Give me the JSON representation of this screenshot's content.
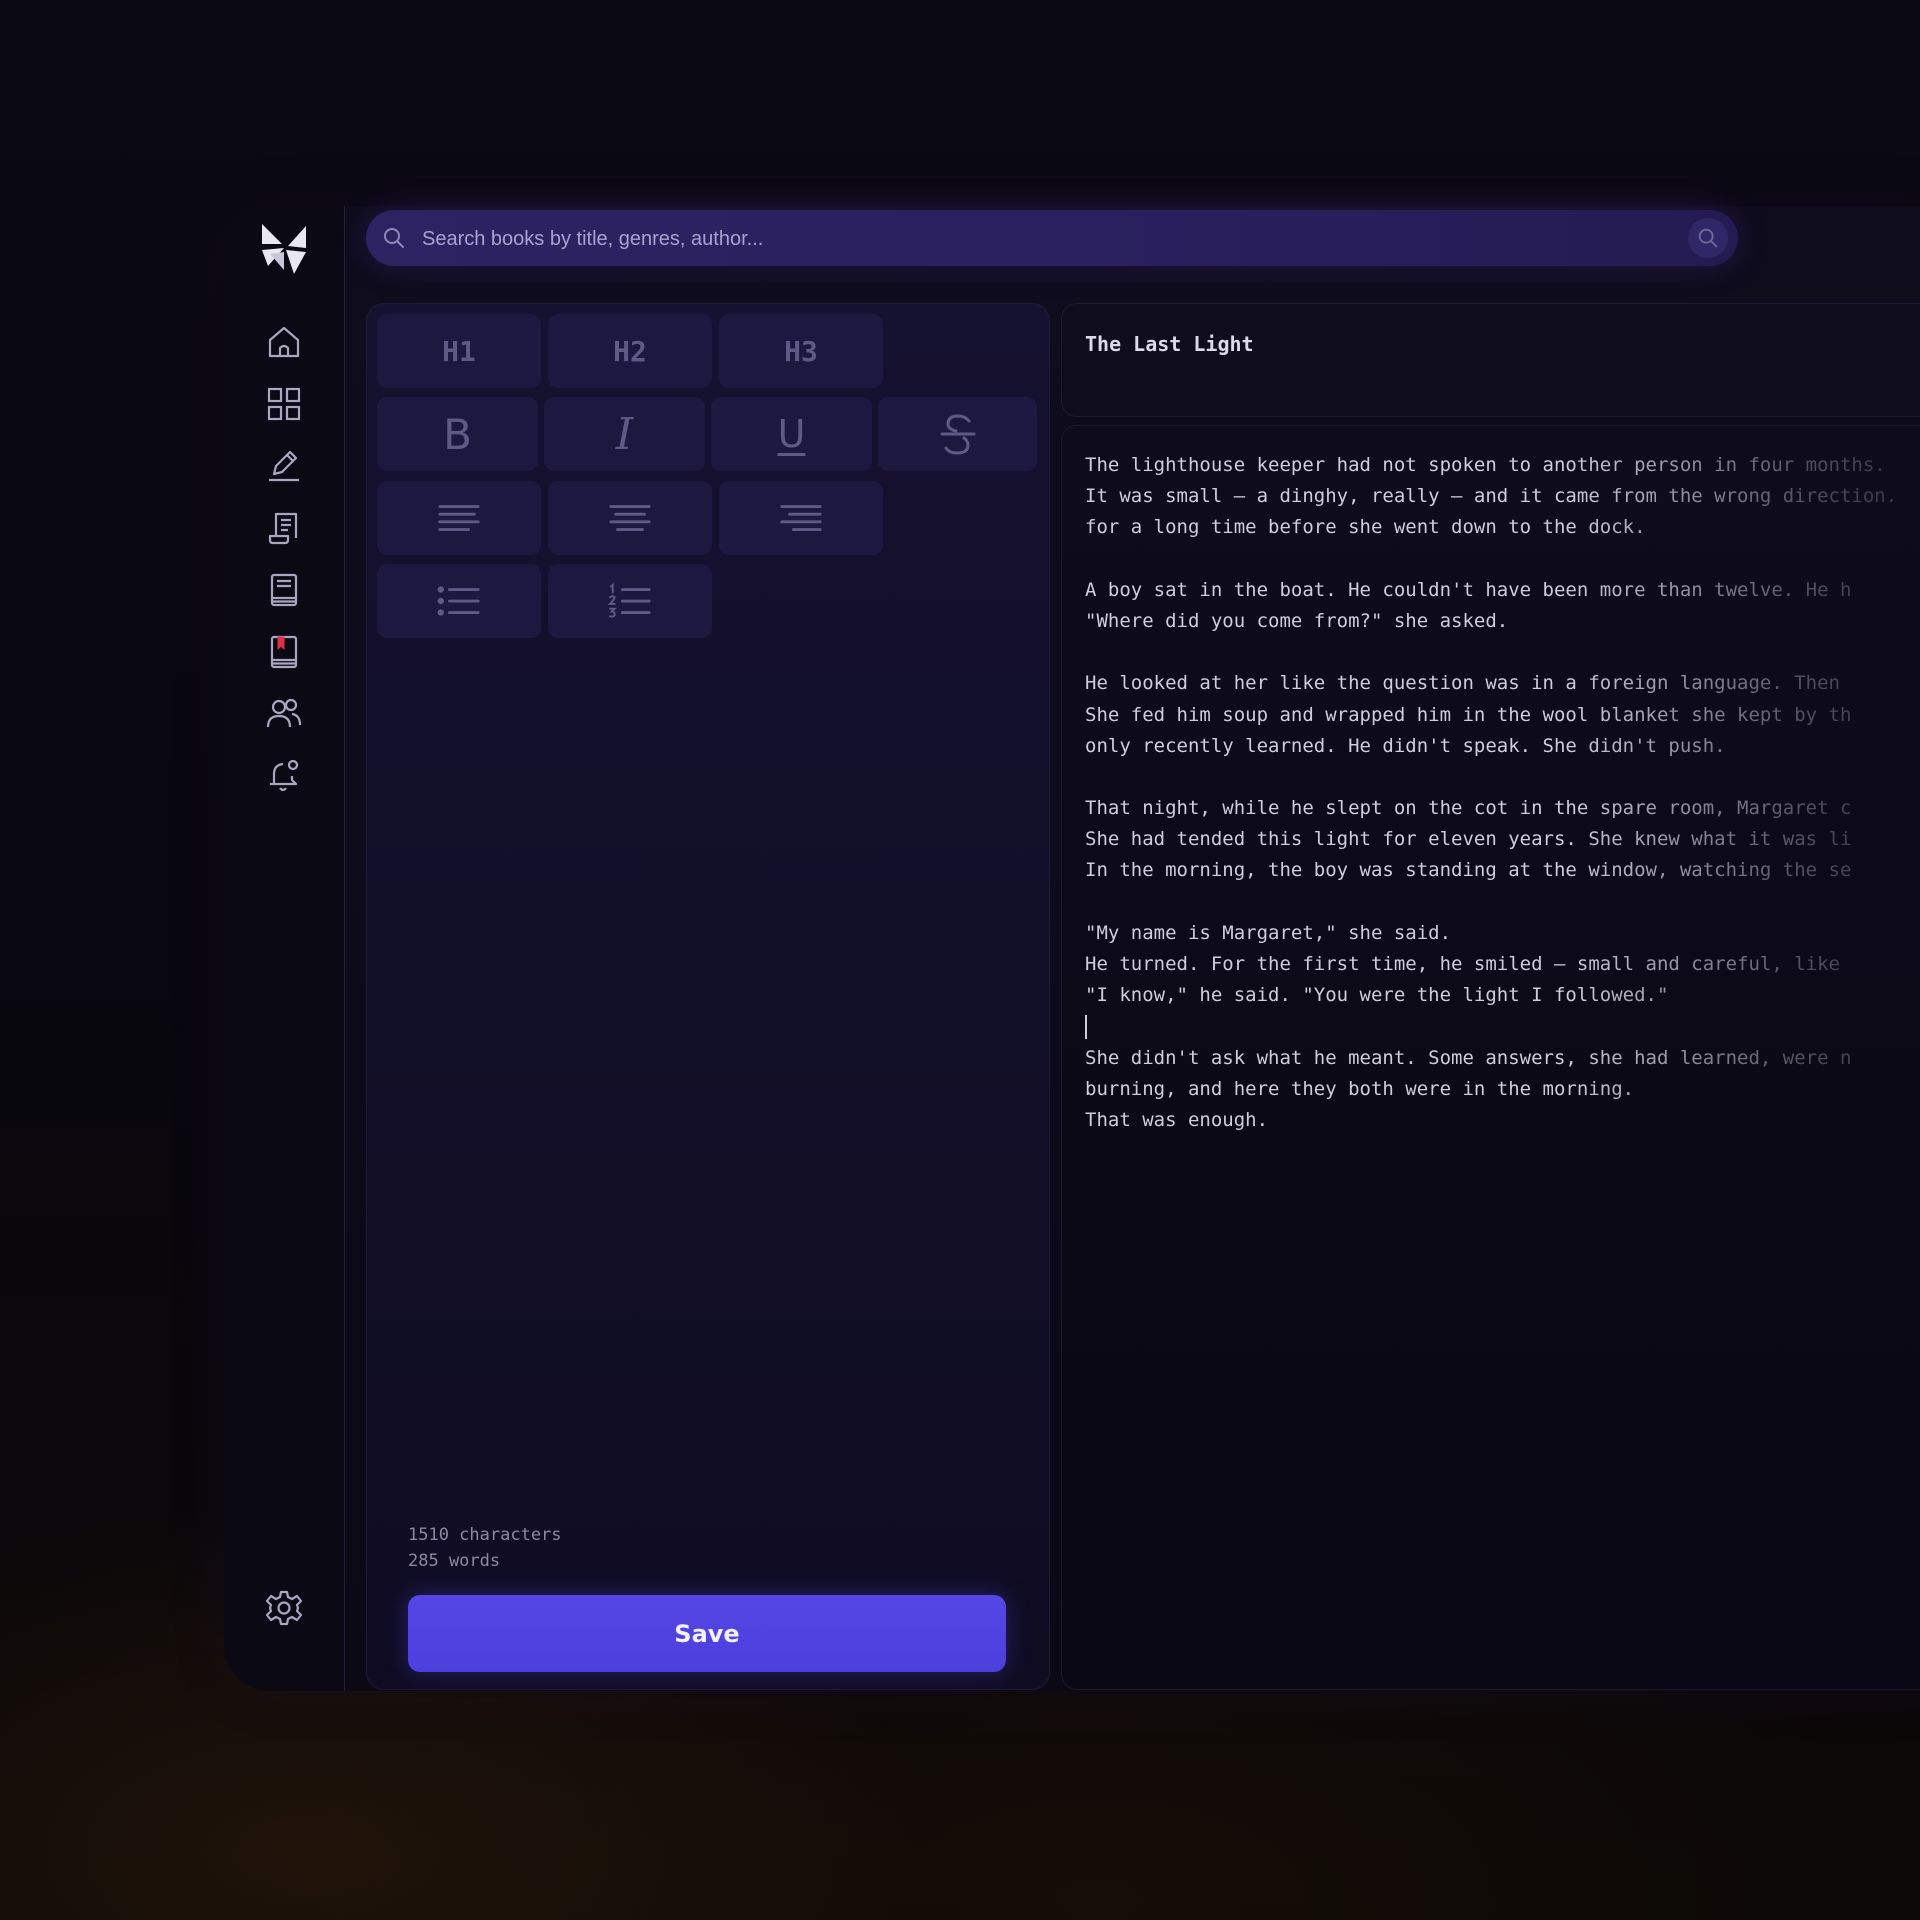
{
  "search": {
    "placeholder": "Search books by title, genres, author..."
  },
  "sidebar": {
    "items": [
      {
        "icon": "home-icon"
      },
      {
        "icon": "grid-icon"
      },
      {
        "icon": "pen-icon"
      },
      {
        "icon": "script-icon"
      },
      {
        "icon": "book-icon"
      },
      {
        "icon": "bookmark-book-icon"
      },
      {
        "icon": "users-icon"
      },
      {
        "icon": "bell-icon"
      }
    ],
    "settings_icon": "gear-icon"
  },
  "toolbar": {
    "h1": "H1",
    "h2": "H2",
    "h3": "H3",
    "bold": "B",
    "italic": "I",
    "underline": "U"
  },
  "stats": {
    "characters": "1510 characters",
    "words": "285 words"
  },
  "save_label": "Save",
  "editor": {
    "title": "The Last Light",
    "lines": [
      "The lighthouse keeper had not spoken to another person in four months.",
      "It was small — a dinghy, really — and it came from the wrong direction.",
      "for a long time before she went down to the dock.",
      "",
      "A boy sat in the boat. He couldn't have been more than twelve. He h",
      "\"Where did you come from?\" she asked.",
      "",
      "He looked at her like the question was in a foreign language. Then",
      "She fed him soup and wrapped him in the wool blanket she kept by th",
      "only recently learned. He didn't speak. She didn't push.",
      "",
      "That night, while he slept on the cot in the spare room, Margaret c",
      "She had tended this light for eleven years. She knew what it was li",
      "In the morning, the boy was standing at the window, watching the se",
      "",
      "\"My name is Margaret,\" she said.",
      "He turned. For the first time, he smiled — small and careful, like",
      "\"I know,\" he said. \"You were the light I followed.\"",
      "",
      "She didn't ask what he meant. Some answers, she had learned, were n",
      "burning, and here they both were in the morning.",
      "That was enough."
    ]
  },
  "colors": {
    "accent": "#5546e6",
    "search_bg": "#2d2363",
    "panel_bg": "#151130",
    "button_bg": "#1c1840"
  }
}
